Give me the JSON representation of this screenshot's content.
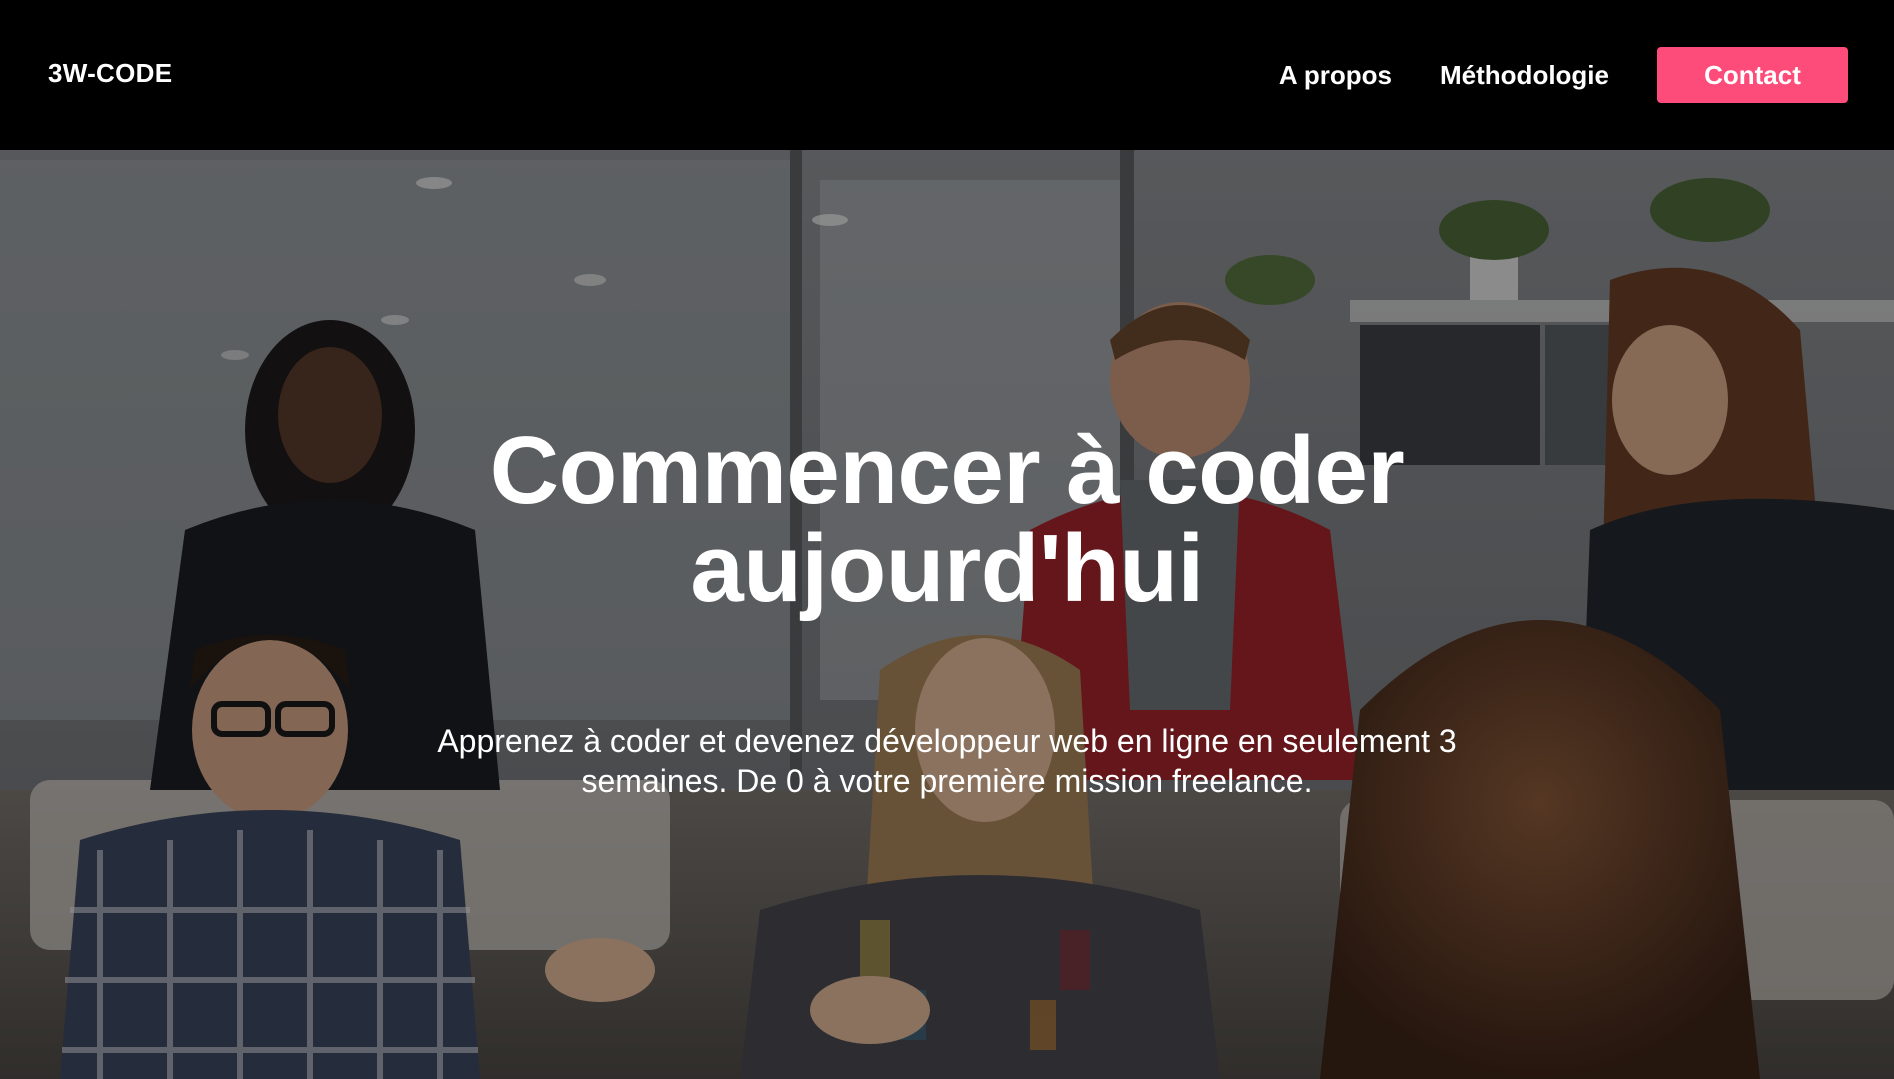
{
  "header": {
    "logo": "3W-CODE",
    "nav": {
      "about_label": "A propos",
      "methodology_label": "Méthodologie",
      "contact_label": "Contact"
    },
    "colors": {
      "background": "#000000",
      "accent": "#fe4c7a",
      "text": "#ffffff"
    }
  },
  "hero": {
    "title": "Commencer à coder aujourd'hui",
    "subtitle": "Apprenez à coder et devenez développeur web en ligne en seulement 3 semaines. De 0 à votre première mission freelance.",
    "background_image": "people-in-office-meeting-photo"
  }
}
